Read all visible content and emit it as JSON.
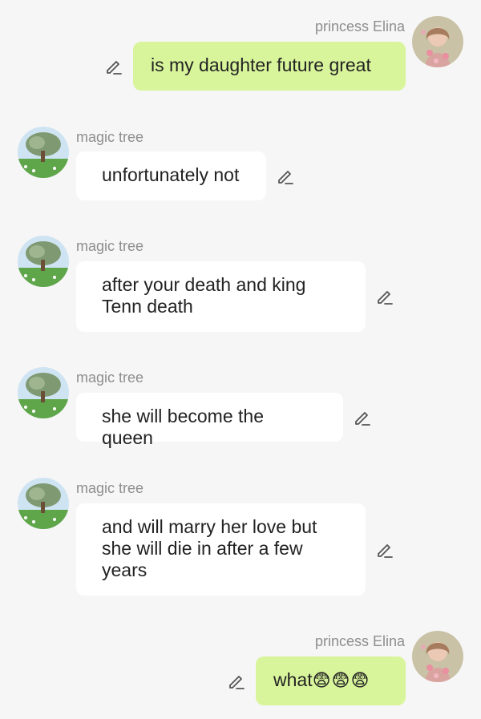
{
  "colors": {
    "background": "#f6f6f6",
    "user_bubble": "#d9f59c",
    "bot_bubble": "#ffffff",
    "sender_name": "#8e8e8e",
    "text": "#222222"
  },
  "messages": [
    {
      "sender": "princess Elina",
      "text": "is my daughter future great"
    },
    {
      "sender": "magic tree",
      "text": "unfortunately not"
    },
    {
      "sender": "magic tree",
      "text": "after your death and king Tenn death"
    },
    {
      "sender": "magic tree",
      "text": "she will become the queen"
    },
    {
      "sender": "magic tree",
      "text": "and will marry her love but she will die in after a few years"
    },
    {
      "sender": "princess Elina",
      "text": "what",
      "emoji": "😨😨😨"
    }
  ]
}
